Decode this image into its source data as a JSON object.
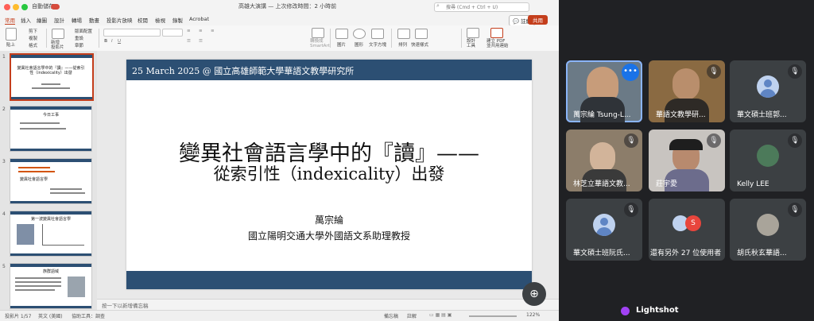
{
  "titlebar": {
    "autosave_label": "自動儲存",
    "doc_title": "高雄大演講 — 上次修改時間：2 小時前",
    "search_placeholder": "搜尋 (Cmd + Ctrl + U)"
  },
  "ribbon_tabs": [
    "常用",
    "插入",
    "繪圖",
    "設計",
    "轉場",
    "動畫",
    "投影片放映",
    "校閱",
    "檢視",
    "錄製",
    "Acrobat"
  ],
  "active_tab_index": 0,
  "ribbon_actions": {
    "comment": "註解",
    "share": "共用"
  },
  "ribbon": {
    "paste": "貼上",
    "cut": "剪下",
    "copy": "複製",
    "format": "格式",
    "new_slide": "新增\n投影片",
    "layout": "版面配置",
    "reset": "重設",
    "section": "章節",
    "convert_smartart": "轉換成\nSmartArt",
    "picture": "圖片",
    "shapes": "圖形",
    "textbox": "文字方塊",
    "arrange": "排列",
    "quick_styles": "快速樣式",
    "design_ideas": "設計\n工具",
    "pdf": "建立 PDF\n並共用連結"
  },
  "thumbnails": [
    {
      "num": "1",
      "selected": true,
      "title": "變異社會語言學中的『讀』——從索引性（indexicality）出發"
    },
    {
      "num": "2",
      "selected": false,
      "title": "今日工事"
    },
    {
      "num": "3",
      "selected": false,
      "title": "變異社會語言學"
    },
    {
      "num": "4",
      "selected": false,
      "title": "第一波變異社會語言學"
    },
    {
      "num": "5",
      "selected": false,
      "title": "族群語域"
    }
  ],
  "slide": {
    "date_line": "25 March 2025 @ 國立高雄師範大學華語文教學研究所",
    "title_line1": "變異社會語言學中的『讀』——",
    "title_line2": "從索引性（indexicality）出發",
    "author": "萬宗綸",
    "affiliation": "國立陽明交通大學外國語文系助理教授"
  },
  "notes_placeholder": "按一下以新增備忘稿",
  "statusbar": {
    "slide_count": "投影片 1/57",
    "language": "英文 (美國)",
    "accessibility": "協助工具：調查",
    "notes": "備忘稿",
    "comments": "註解",
    "zoom": "122%"
  },
  "participants": [
    {
      "name": "萬宗綸 Tsung-L...",
      "video": true,
      "muted": false,
      "active": true
    },
    {
      "name": "華語文教學研...",
      "video": true,
      "muted": true,
      "active": false
    },
    {
      "name": "華文碩士班郭...",
      "video": false,
      "muted": true,
      "active": false
    },
    {
      "name": "林芝立華語文教...",
      "video": true,
      "muted": true,
      "active": false
    },
    {
      "name": "莊宇愛",
      "video": true,
      "muted": true,
      "active": false
    },
    {
      "name": "Kelly LEE",
      "video": false,
      "muted": true,
      "active": false
    },
    {
      "name": "華文碩士班阮氏...",
      "video": false,
      "muted": true,
      "active": false
    },
    {
      "name": "還有另外 27 位使用者",
      "video": false,
      "muted": false,
      "active": false
    },
    {
      "name": "胡氏秋玄華語...",
      "video": false,
      "muted": true,
      "active": false
    }
  ],
  "others_badge": "S",
  "lightshot_label": "Lightshot",
  "colors": {
    "accent": "#c43e1c",
    "slide_band": "#2c4f73",
    "meet_bg": "#202124",
    "tile_bg": "#3c4043",
    "speaking": "#8ab4f8"
  }
}
